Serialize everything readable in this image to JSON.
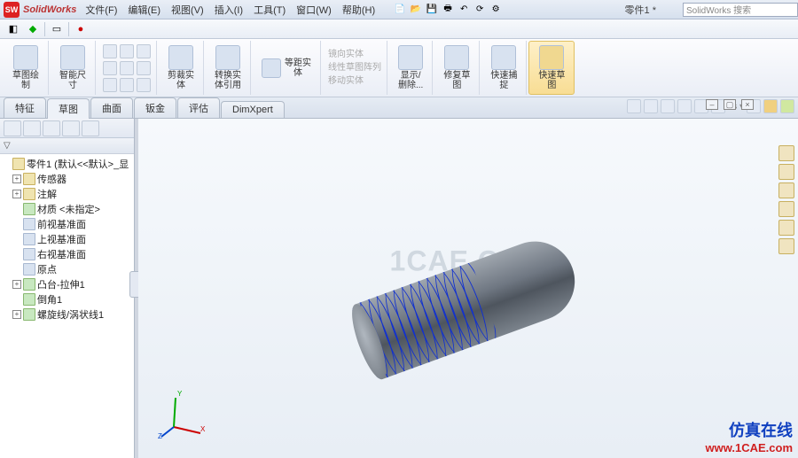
{
  "app": {
    "logo_text": "SW",
    "name_html": "SolidWorks",
    "doc_title": "零件1 *",
    "search_placeholder": "SolidWorks 搜索"
  },
  "menus": [
    "文件(F)",
    "编辑(E)",
    "视图(V)",
    "插入(I)",
    "工具(T)",
    "窗口(W)",
    "帮助(H)"
  ],
  "ribbon": {
    "sketch_btn": "草图绘\n制",
    "smart_dim": "智能尺\n寸",
    "trim": "剪裁实\n体",
    "convert": "转换实\n体引用",
    "offset": "等距实\n体",
    "pattern_rows": [
      "镜向实体",
      "线性草图阵列",
      "移动实体"
    ],
    "show_del": "显示/\n删除...",
    "repair": "修复草\n图",
    "quick_snap": "快速捕\n捉",
    "quick_sketch": "快速草\n图"
  },
  "tabs": [
    "特征",
    "草图",
    "曲面",
    "钣金",
    "评估",
    "DimXpert"
  ],
  "tree": {
    "root": "零件1 (默认<<默认>_显",
    "items": [
      {
        "label": "传感器",
        "icon": "y",
        "exp": "+"
      },
      {
        "label": "注解",
        "icon": "y",
        "exp": "+"
      },
      {
        "label": "材质 <未指定>",
        "icon": "g",
        "exp": ""
      },
      {
        "label": "前视基准面",
        "icon": "",
        "exp": ""
      },
      {
        "label": "上视基准面",
        "icon": "",
        "exp": ""
      },
      {
        "label": "右视基准面",
        "icon": "",
        "exp": ""
      },
      {
        "label": "原点",
        "icon": "",
        "exp": ""
      },
      {
        "label": "凸台-拉伸1",
        "icon": "g",
        "exp": "+"
      },
      {
        "label": "倒角1",
        "icon": "g",
        "exp": ""
      },
      {
        "label": "螺旋线/涡状线1",
        "icon": "g",
        "exp": "+"
      }
    ]
  },
  "watermark": "1CAE.COM",
  "brand": {
    "cn": "仿真在线",
    "url": "www.1CAE.com"
  },
  "triad": {
    "x": "X",
    "y": "Y",
    "z": "Z"
  },
  "colors": {
    "accent": "#1030d0",
    "warn": "#d02020"
  }
}
